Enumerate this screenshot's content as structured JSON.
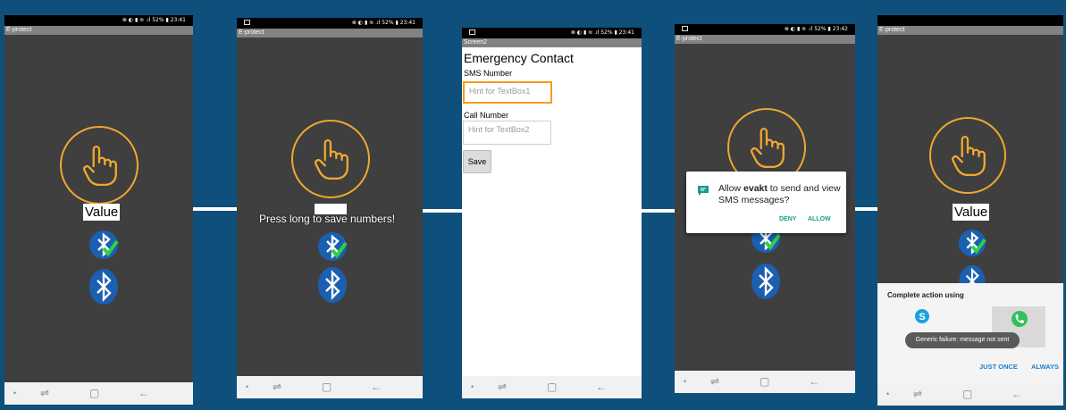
{
  "colors": {
    "background": "#0f4f7c",
    "app_bg": "#3f3f3f",
    "accent": "#f0a830",
    "bluetooth": "#1b5fb0",
    "dialog_button": "#1a9a8c",
    "sheet_button": "#1f7fd0"
  },
  "screens": [
    {
      "status": "⊗ ◐ ▮ ≋ .ıl 52% ▮ 23:41",
      "app_title": "E-protect",
      "value_label": "Value",
      "icons": [
        "hand-pointer-icon",
        "bluetooth-connected-icon",
        "bluetooth-icon"
      ]
    },
    {
      "status": "⊗ ◐ ▮ ≋ .ıl 52% ▮ 23:41",
      "app_title": "E-protect",
      "toast": "Press long to save numbers!",
      "icons": [
        "hand-pointer-icon",
        "bluetooth-connected-icon",
        "bluetooth-icon"
      ]
    },
    {
      "status": "⊗ ◐ ▮ ≋ .ıl 52% ▮ 23:41",
      "app_title": "Screen2",
      "heading": "Emergency Contact",
      "sms_label": "SMS Number",
      "sms_placeholder": "Hint for TextBox1",
      "call_label": "Call Number",
      "call_placeholder": "Hint for TextBox2",
      "save_label": "Save"
    },
    {
      "status": "⊗ ◐ ▮ ≋ .ıl 52% ▮ 23:42",
      "app_title": "E-protect",
      "dialog": {
        "text_pre": "Allow ",
        "text_app": "evakt",
        "text_post": " to send and view SMS messages?",
        "deny": "DENY",
        "allow": "ALLOW"
      }
    },
    {
      "status": "",
      "app_title": "E-protect",
      "value_label": "Value",
      "sheet": {
        "title": "Complete action using",
        "toast": "Generic failure: message not sent",
        "just_once": "JUST ONCE",
        "always": "ALWAYS"
      }
    }
  ],
  "nav_glyphs": {
    "dot": "•",
    "recent": "⇌",
    "home": "▢",
    "back": "←"
  }
}
